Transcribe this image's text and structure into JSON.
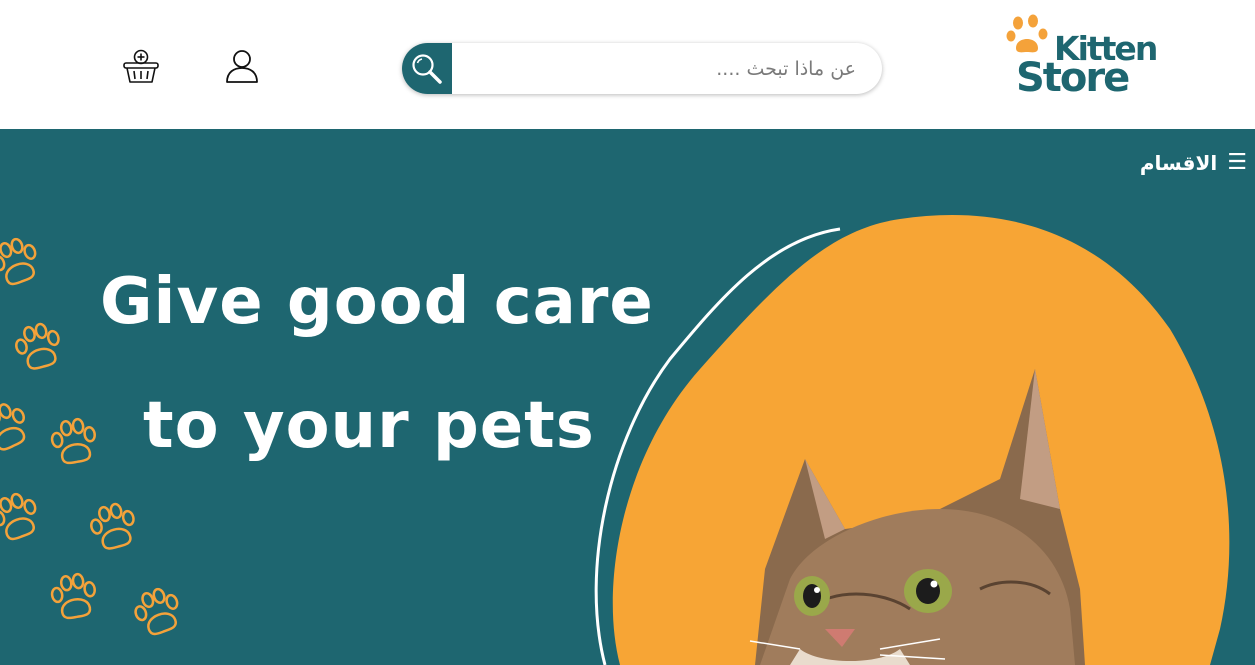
{
  "brand": {
    "line1": "Kitten",
    "line2": "Store",
    "accent_color": "#f4a23a",
    "primary_color": "#1e6670"
  },
  "search": {
    "placeholder": "عن ماذا تبحث ....",
    "value": ""
  },
  "header_icons": [
    "user-icon",
    "cart-icon"
  ],
  "nav": {
    "categories_label": "الاقسام",
    "categories_icon": "hamburger-icon"
  },
  "hero": {
    "line1": "Give good care",
    "line2": "to your pets",
    "background_color": "#1e6670",
    "blob_color": "#f7a535"
  }
}
